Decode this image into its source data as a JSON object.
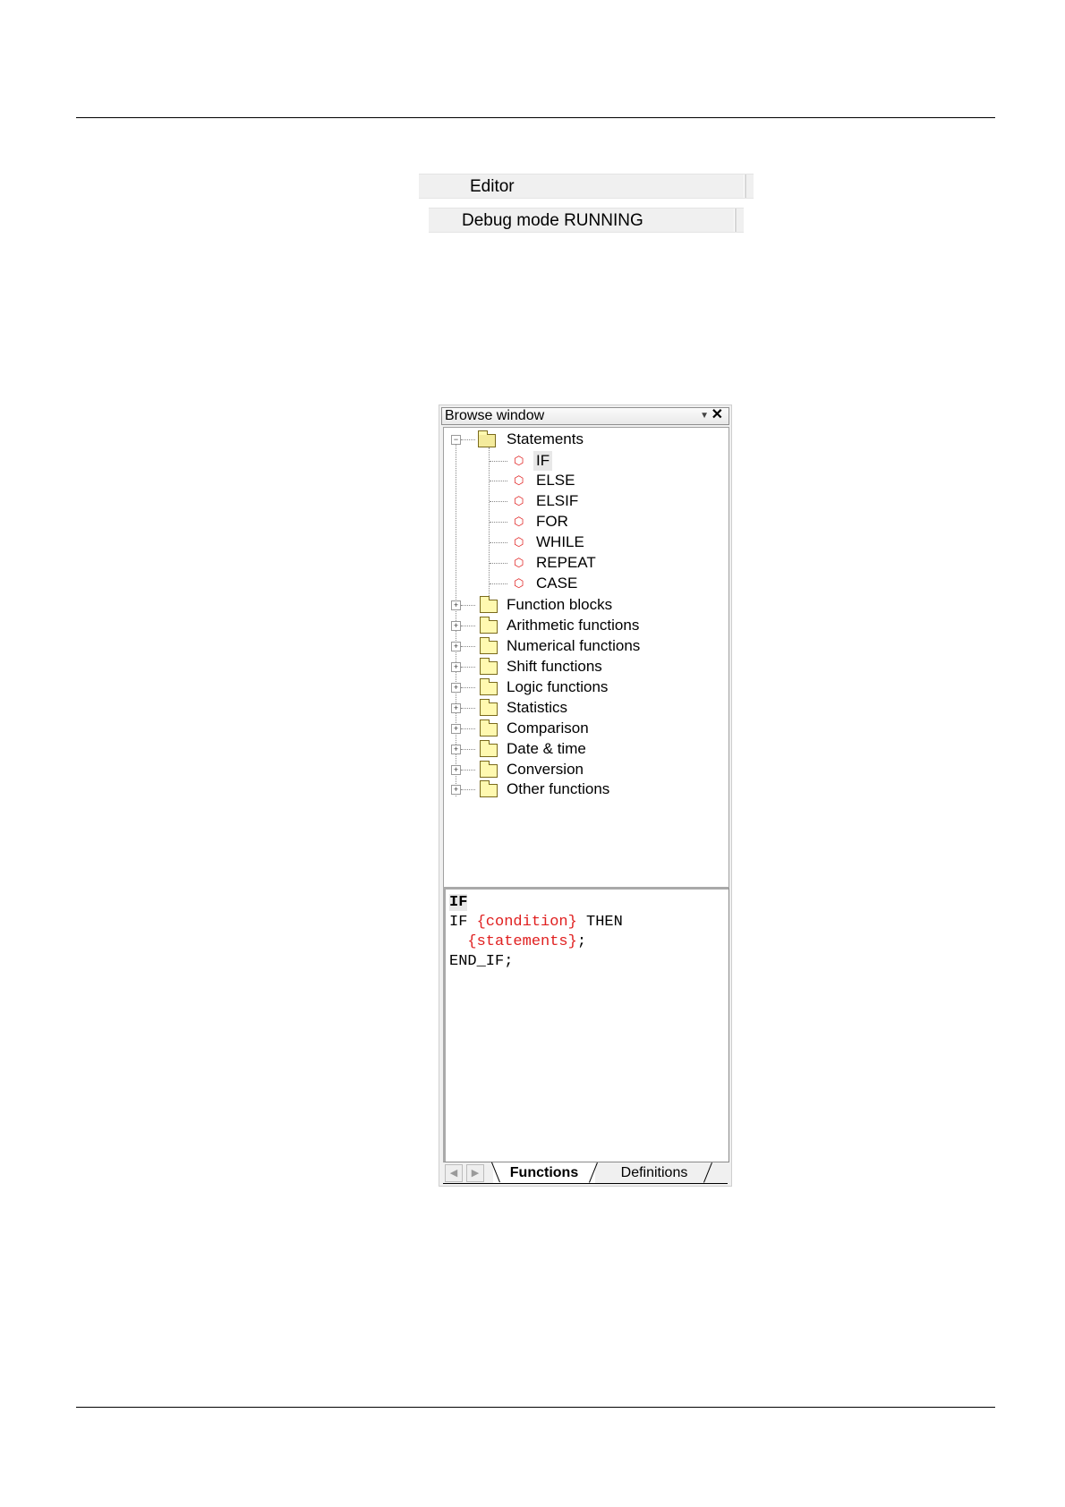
{
  "status_bars": {
    "editor": "Editor",
    "debug": "Debug mode RUNNING"
  },
  "browse_window": {
    "title": "Browse window",
    "tree": {
      "root": "Statements",
      "statements": [
        "IF",
        "ELSE",
        "ELSIF",
        "FOR",
        "WHILE",
        "REPEAT",
        "CASE"
      ],
      "folders": [
        "Function blocks",
        "Arithmetic functions",
        "Numerical functions",
        "Shift functions",
        "Logic functions",
        "Statistics",
        "Comparison",
        "Date & time",
        "Conversion",
        "Other functions"
      ]
    },
    "code": {
      "header": "IF",
      "line1_a": "IF ",
      "line1_b": "{condition}",
      "line1_c": " THEN",
      "line2_indent": "  ",
      "line2_b": "{statements}",
      "line2_c": ";",
      "line3": "END_IF;"
    },
    "tabs": {
      "active": "Functions",
      "inactive": "Definitions"
    }
  },
  "colors": {
    "placeholder": "#e02020",
    "folder": "#fff9b0"
  }
}
